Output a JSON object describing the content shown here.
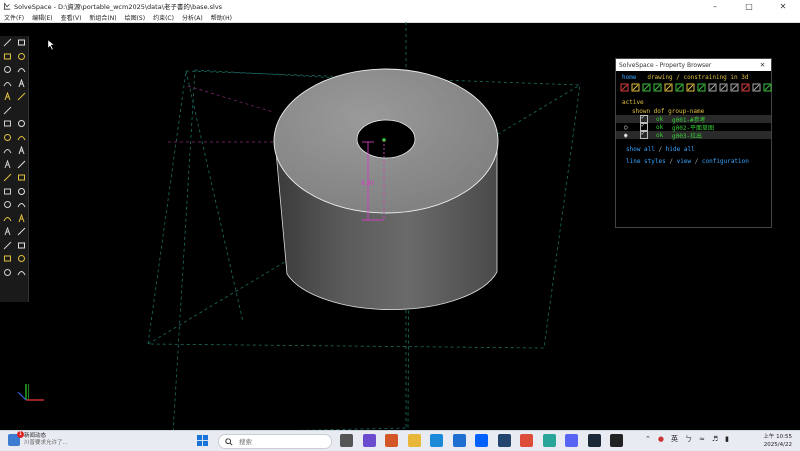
{
  "window": {
    "title": "SolveSpace - D:\\資源\\portable_wcm2025\\data\\老子書的\\base.slvs",
    "controls": [
      "minimize-icon",
      "maximize-icon",
      "close-icon"
    ]
  },
  "menu": [
    "文件(F)",
    "编辑(E)",
    "查看(V)",
    "新组合(N)",
    "绘图(S)",
    "约束(C)",
    "分析(A)",
    "帮助(H)"
  ],
  "toolbar_icons": [
    [
      "line-icon",
      "rectangle-icon"
    ],
    [
      "circle-icon",
      "arc-icon"
    ],
    [
      "text-icon",
      "image-icon"
    ],
    [
      "bezier-icon",
      "spline-icon"
    ],
    [
      "point-icon",
      "tangent-arc-icon"
    ],
    [
      "split-icon",
      ""
    ],
    [
      "distance-icon",
      "angle-icon"
    ],
    [
      "horizontal-icon",
      "vertical-icon"
    ],
    [
      "parallel-icon",
      "perpendicular-icon"
    ],
    [
      "symmetric-icon",
      "midpoint-icon"
    ],
    [
      "equal-icon",
      "ratio-icon"
    ],
    [
      "ref-icon",
      "nearest-icon"
    ],
    [
      "extrude-icon",
      "lathe-icon"
    ],
    [
      "revolve-icon",
      "helix-icon"
    ],
    [
      "step-icon",
      "translate-icon"
    ],
    [
      "rotate-icon",
      "link-icon"
    ],
    [
      "workplane-icon",
      "sketch-icon"
    ],
    [
      "assemble-icon",
      "section-icon"
    ]
  ],
  "viewport": {
    "dimension_label": "8.80",
    "part_color": "#5f5f5f"
  },
  "property_browser": {
    "title": "SolveSpace - Property Browser",
    "nav": {
      "home": "home",
      "current": "drawing / constraining in 3d"
    },
    "active_label": "active",
    "header": "shown dof group-name",
    "groups": [
      {
        "radio": "",
        "dof": "ok",
        "name": "g001-#参考"
      },
      {
        "radio": "○",
        "dof": "ok",
        "name": "g002-平面草图"
      },
      {
        "radio": "◉",
        "dof": "ok",
        "name": "g003-拉出"
      }
    ],
    "links1": {
      "a": "show all",
      "b": "hide all"
    },
    "links2": {
      "a": "line styles",
      "b": "view",
      "c": "configuration"
    }
  },
  "taskbar": {
    "notification": {
      "title": "新闻动态",
      "subtitle": "川普要求允许了..."
    },
    "search_placeholder": "搜索",
    "tray": {
      "lang": "英",
      "ime": "ㄅ"
    },
    "clock": {
      "time": "上午 10:55",
      "date": "2025/4/22"
    }
  }
}
